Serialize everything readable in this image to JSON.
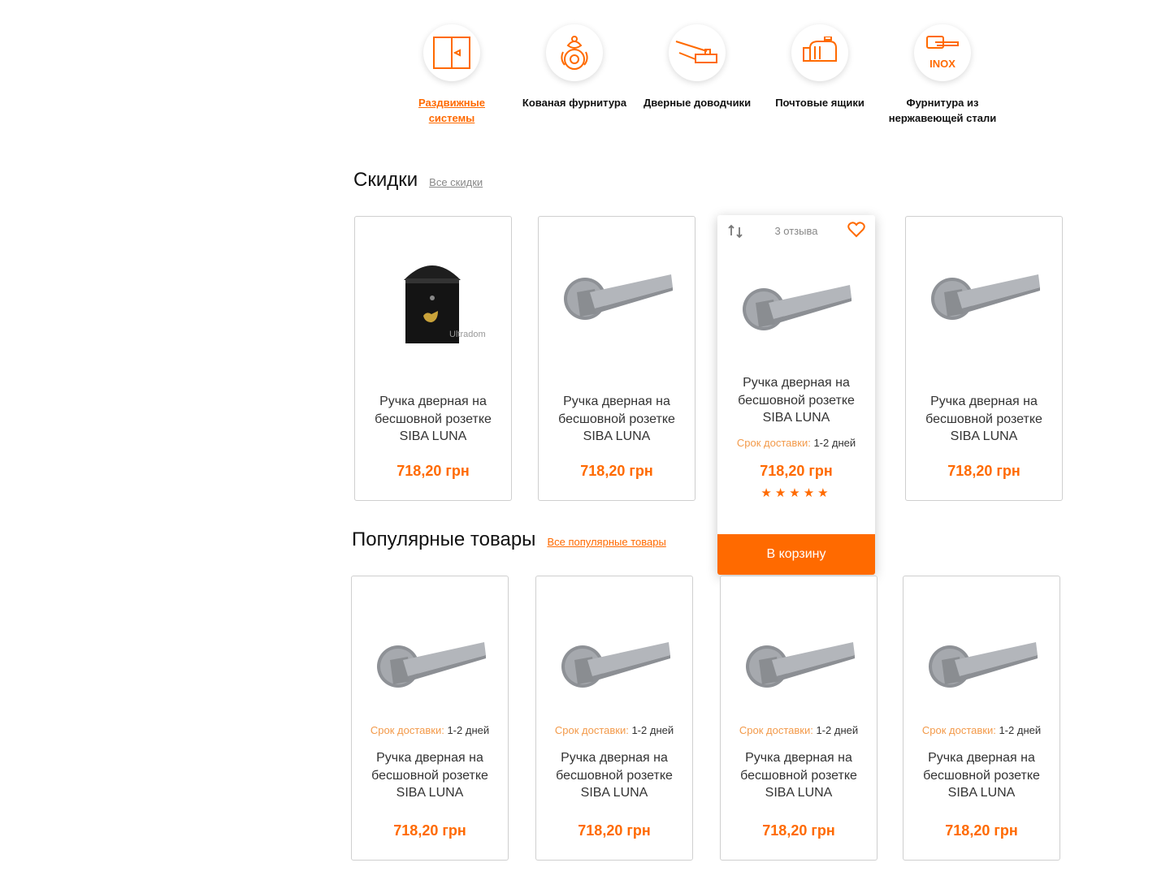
{
  "categories": [
    {
      "label": "Раздвижные системы",
      "active": true,
      "icon": "sliding-door-icon"
    },
    {
      "label": "Кованая фурнитура",
      "active": false,
      "icon": "forged-knocker-icon"
    },
    {
      "label": "Дверные доводчики",
      "active": false,
      "icon": "door-closer-icon"
    },
    {
      "label": "Почтовые ящики",
      "active": false,
      "icon": "mailbox-icon"
    },
    {
      "label": "Фурнитура из нержавеющей стали",
      "active": false,
      "icon": "inox-handle-icon",
      "icon_text": "INOX"
    }
  ],
  "sale": {
    "title": "Скидки",
    "all_link": "Все скидки",
    "products": [
      {
        "name": "Ручка дверная на бесшовной розетке SIBA LUNA",
        "price": "718,20 грн",
        "image": "mailbox-image"
      },
      {
        "name": "Ручка дверная на бесшовной розетке SIBA LUNA",
        "price": "718,20 грн",
        "image": "door-handle-image"
      },
      {
        "name": "Ручка дверная на бесшовной розетке SIBA LUNA",
        "price": "718,20 грн",
        "image": "door-handle-image",
        "reviews": "3 отзыва",
        "delivery_label": "Срок доставки:",
        "delivery_value": "1-2 дней",
        "rating": 5,
        "stars": "★★★★★",
        "cart": "В корзину"
      },
      {
        "name": "Ручка дверная на бесшовной розетке SIBA LUNA",
        "price": "718,20 грн",
        "image": "door-handle-image"
      }
    ]
  },
  "popular": {
    "title": "Популярные товары",
    "all_link": "Все популярные товары",
    "products": [
      {
        "name": "Ручка дверная на бесшовной розетке SIBA LUNA",
        "price": "718,20 грн",
        "delivery_label": "Срок доставки:",
        "delivery_value": "1-2 дней"
      },
      {
        "name": "Ручка дверная на бесшовной розетке SIBA LUNA",
        "price": "718,20 грн",
        "delivery_label": "Срок доставки:",
        "delivery_value": "1-2 дней"
      },
      {
        "name": "Ручка дверная на бесшовной розетке SIBA LUNA",
        "price": "718,20 грн",
        "delivery_label": "Срок доставки:",
        "delivery_value": "1-2 дней"
      },
      {
        "name": "Ручка дверная на бесшовной розетке SIBA LUNA",
        "price": "718,20 грн",
        "delivery_label": "Срок доставки:",
        "delivery_value": "1-2 дней"
      }
    ]
  },
  "watermark": "Ultradom",
  "colors": {
    "accent": "#ff6a00",
    "delivery_label": "#f39a4a",
    "border": "#cfcfcf"
  }
}
